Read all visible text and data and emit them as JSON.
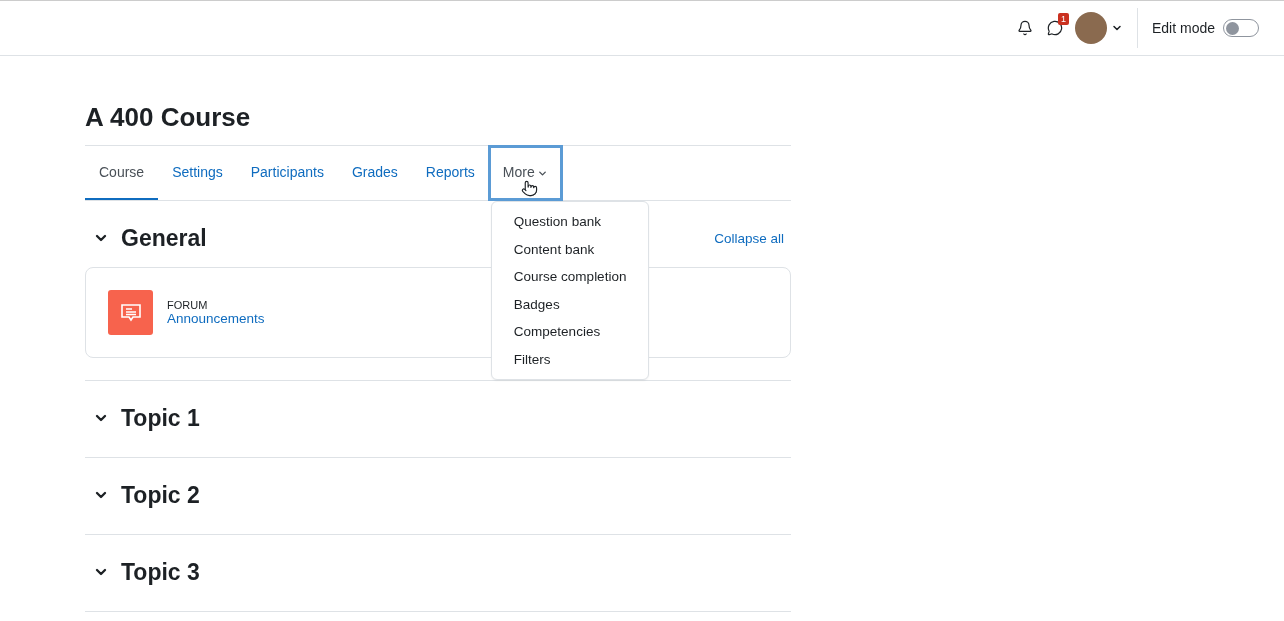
{
  "header": {
    "messages": {
      "count": "1"
    },
    "edit_mode": {
      "label": "Edit mode",
      "on": false
    }
  },
  "course": {
    "title": "A 400 Course"
  },
  "tabs": [
    {
      "label": "Course",
      "selected": true,
      "kind": "link"
    },
    {
      "label": "Settings",
      "selected": false,
      "kind": "link"
    },
    {
      "label": "Participants",
      "selected": false,
      "kind": "link"
    },
    {
      "label": "Grades",
      "selected": false,
      "kind": "link"
    },
    {
      "label": "Reports",
      "selected": false,
      "kind": "link"
    },
    {
      "label": "More",
      "selected": false,
      "kind": "dropdown",
      "expanded": true,
      "menu": [
        "Question bank",
        "Content bank",
        "Course completion",
        "Badges",
        "Competencies",
        "Filters"
      ]
    }
  ],
  "collapse_all": "Collapse all",
  "sections": [
    {
      "title": "General",
      "activities": [
        {
          "type": "FORUM",
          "name": "Announcements"
        }
      ]
    },
    {
      "title": "Topic 1"
    },
    {
      "title": "Topic 2"
    },
    {
      "title": "Topic 3"
    }
  ]
}
